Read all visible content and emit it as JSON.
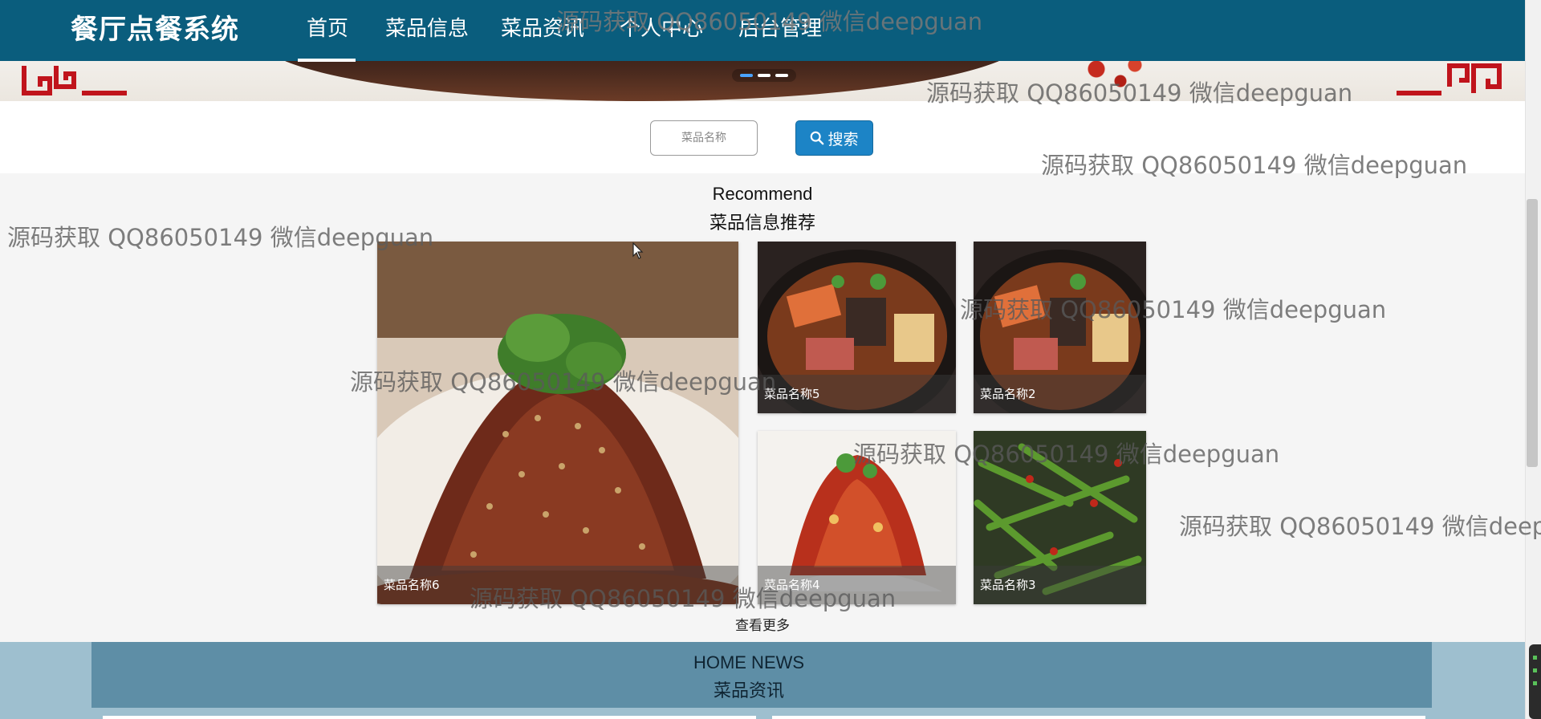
{
  "header": {
    "brand": "餐厅点餐系统",
    "nav": [
      {
        "label": "首页",
        "active": true
      },
      {
        "label": "菜品信息"
      },
      {
        "label": "菜品资讯"
      },
      {
        "label": "个人中心"
      },
      {
        "label": "后台管理"
      }
    ]
  },
  "banner": {
    "slides": 3,
    "active_slide": 1
  },
  "search": {
    "placeholder": "菜品名称",
    "button_label": "搜索"
  },
  "recommend": {
    "title_en": "Recommend",
    "title_cn": "菜品信息推荐",
    "items": [
      {
        "name": "菜品名称6"
      },
      {
        "name": "菜品名称5"
      },
      {
        "name": "菜品名称2"
      },
      {
        "name": "菜品名称4"
      },
      {
        "name": "菜品名称3"
      }
    ],
    "view_more": "查看更多"
  },
  "news": {
    "title_en": "HOME NEWS",
    "title_cn": "菜品资讯"
  },
  "watermark": "源码获取 QQ86050149 微信deepguan",
  "colors": {
    "navbar": "#0a5d7d",
    "search_button": "#1c84c6",
    "news_header": "#5e8ea6",
    "news_background": "#9ebfcf"
  }
}
